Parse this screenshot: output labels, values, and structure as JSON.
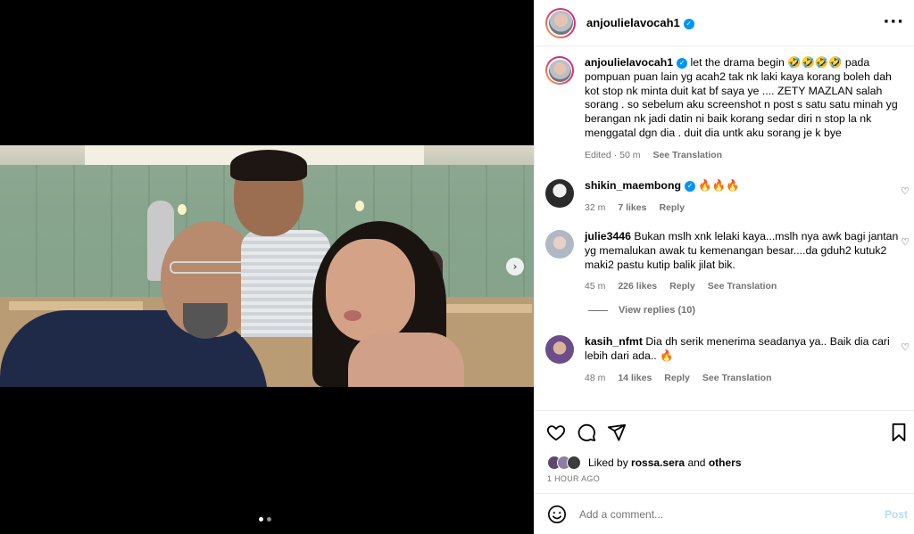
{
  "post": {
    "author": "anjoulielavocah1",
    "caption_author": "anjoulielavocah1",
    "caption_text": "let the drama begin 🤣🤣🤣🤣 pada pompuan puan lain yg acah2 tak nk laki kaya korang boleh dah kot stop nk minta duit kat bf saya ye .... ZETY MAZLAN salah sorang . so sebelum aku screenshot n post s satu satu minah yg berangan nk jadi datin ni baik korang sedar diri n stop la nk menggatal dgn dia . duit dia untk aku sorang je k bye",
    "caption_meta": {
      "edited": "Edited · 50 m",
      "see_translation": "See Translation"
    },
    "media_pagination": {
      "total": 2,
      "current": 1
    }
  },
  "comments": [
    {
      "username": "shikin_maembong",
      "verified": true,
      "text": "🔥🔥🔥",
      "time": "32 m",
      "likes": "7 likes",
      "reply": "Reply"
    },
    {
      "username": "julie3446",
      "verified": false,
      "text": "Bukan mslh xnk lelaki kaya...mslh nya awk bagi jantan yg memalukan awak tu kemenangan besar....da gduh2 kutuk2 maki2 pastu kutip balik jilat bik.",
      "time": "45 m",
      "likes": "226 likes",
      "reply": "Reply",
      "see_translation": "See Translation"
    },
    {
      "username": "kasih_nfmt",
      "verified": false,
      "text": "Dia dh serik menerima seadanya ya.. Baik dia cari lebih dari ada.. 🔥",
      "time": "48 m",
      "likes": "14 likes",
      "reply": "Reply",
      "see_translation": "See Translation"
    }
  ],
  "view_replies": "View replies (10)",
  "liked_by": {
    "prefix": "Liked by",
    "user": "rossa.sera",
    "and": "and",
    "others": "others"
  },
  "posted_time": "1 HOUR AGO",
  "comment_box": {
    "placeholder": "Add a comment...",
    "post_label": "Post"
  },
  "icons": {
    "more": "more-options-icon",
    "like": "heart-icon",
    "comment": "comment-icon",
    "share": "share-icon",
    "save": "bookmark-icon",
    "emoji": "emoji-icon",
    "next": "chevron-right-icon"
  },
  "colors": {
    "verified": "#0095f6",
    "post_disabled": "#b3dbff",
    "muted": "#737373"
  }
}
